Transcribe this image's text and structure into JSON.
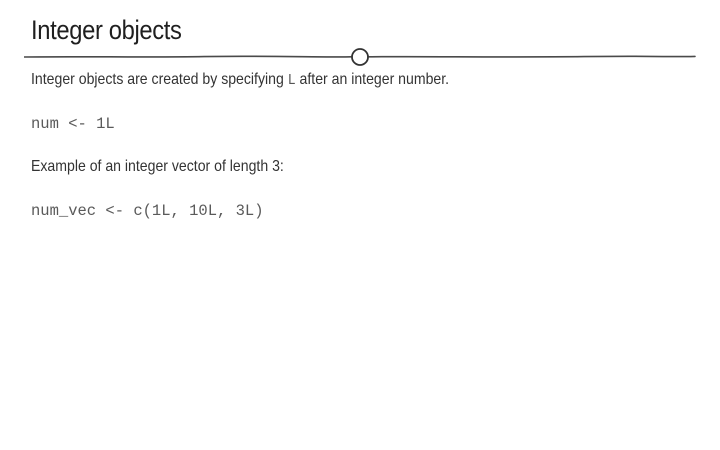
{
  "slide": {
    "title": "Integer objects",
    "para1_before": "Integer objects are created by specifying ",
    "para1_code": "L",
    "para1_after": " after an integer number.",
    "code1": "num <- 1L",
    "para2": "Example of an integer vector of length 3:",
    "code2": "num_vec <- c(1L, 10L, 3L)"
  },
  "colors": {
    "rule": "#4a4a4a",
    "text": "#333333",
    "code": "#5a5a5a"
  }
}
